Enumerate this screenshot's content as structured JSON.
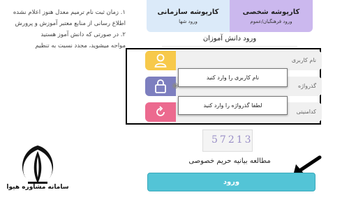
{
  "notes": [
    "۱. زمان ثبت نام ترمیم معدل هنوز اعلام نشده",
    "اطلاع رسانی از منابع معتبر آموزش و پرورش",
    "۲. در صورتی که دانش آموز هستید",
    "مواجه میشوید، مجدد نسبت به تنظیم"
  ],
  "tabs": {
    "personal": {
      "title": "کارپوشه شخصی",
      "subtitle": "ورود فرهنگیان/عموم"
    },
    "organizational": {
      "title": "کارپوشه سازمانی",
      "subtitle": "ورود شها"
    }
  },
  "section_title": "ورود دانش آموزان",
  "fields": {
    "username_label": "نام کاربری",
    "password_label": "گذرواژه",
    "captcha_label": "کدامنیتی"
  },
  "tooltips": {
    "username": "نام کاربری را وارد کنید",
    "password": "لطفا گذرواژه را وارد کنید"
  },
  "captcha_value": "57213",
  "privacy_link": "مطالعه بیانیه حریم خصوصی",
  "login_button": "ورود",
  "logo_text": "سامانه مشاوره هیوا",
  "colors": {
    "username_icon": "#f7c94b",
    "password_icon": "#7d7fbf",
    "captcha_icon": "#ec6a8f",
    "login_button": "#53c4d6"
  }
}
